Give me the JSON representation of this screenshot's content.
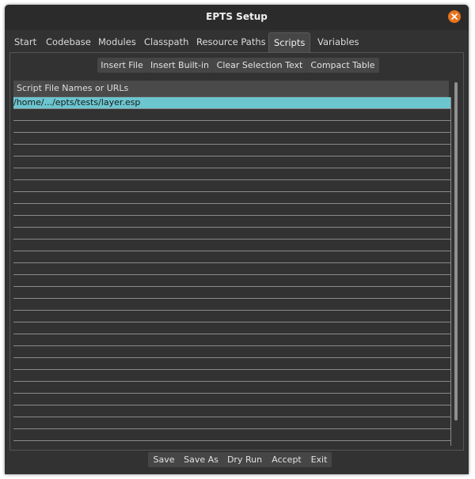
{
  "window": {
    "title": "EPTS Setup"
  },
  "tabs": [
    {
      "label": "Start"
    },
    {
      "label": "Codebase"
    },
    {
      "label": "Modules"
    },
    {
      "label": "Classpath"
    },
    {
      "label": "Resource Paths"
    },
    {
      "label": "Scripts",
      "active": true
    },
    {
      "label": "Variables"
    }
  ],
  "toolbar": {
    "insert_file": "Insert File",
    "insert_builtin": "Insert Built-in",
    "clear_selection": "Clear Selection Text",
    "compact_table": "Compact Table"
  },
  "table": {
    "header": "Script File Names or URLs",
    "rows": [
      "/home/.../epts/tests/layer.esp"
    ],
    "selected_index": 0,
    "empty_rows": 28
  },
  "footer": {
    "save": "Save",
    "save_as": "Save As",
    "dry_run": "Dry Run",
    "accept": "Accept",
    "exit": "Exit"
  },
  "colors": {
    "selection": "#6cc6d0",
    "close_button": "#e8731f",
    "background": "#323232"
  }
}
